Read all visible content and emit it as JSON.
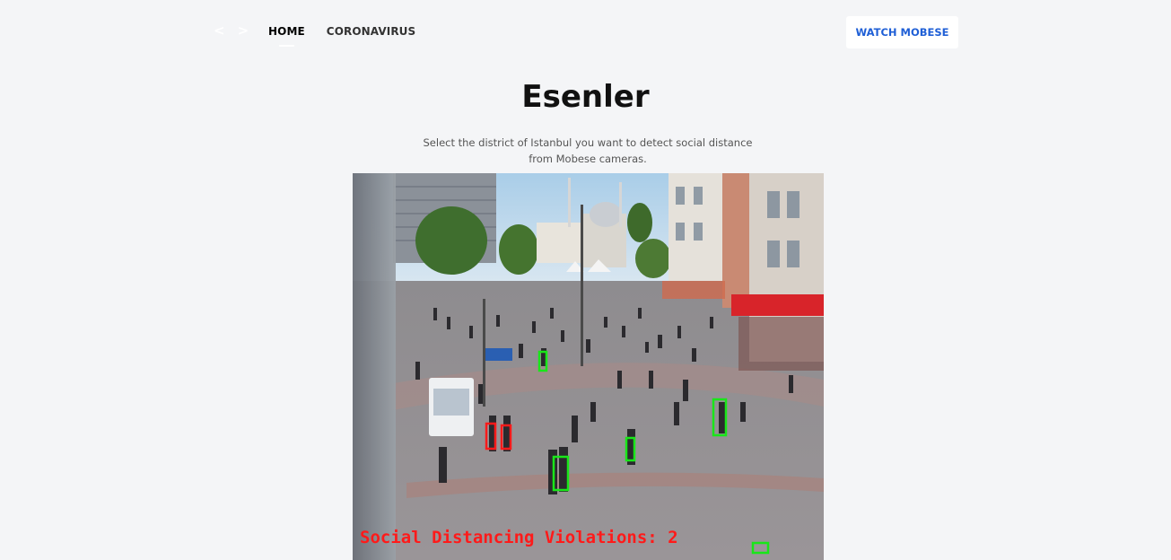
{
  "nav": {
    "back_arrow": "<",
    "forward_arrow": ">",
    "links": [
      {
        "label": "HOME",
        "active": true
      },
      {
        "label": "CORONAVIRUS",
        "active": false
      }
    ],
    "watch_button": "WATCH MOBESE"
  },
  "page": {
    "title": "Esenler",
    "subtitle_line1": "Select the district of Istanbul you want to detect social distance",
    "subtitle_line2": "from Mobese cameras."
  },
  "video": {
    "overlay_text": "Social Distancing Violations: 2",
    "colors": {
      "safe_box": "#19e619",
      "violation_box": "#ff1a1a"
    }
  }
}
